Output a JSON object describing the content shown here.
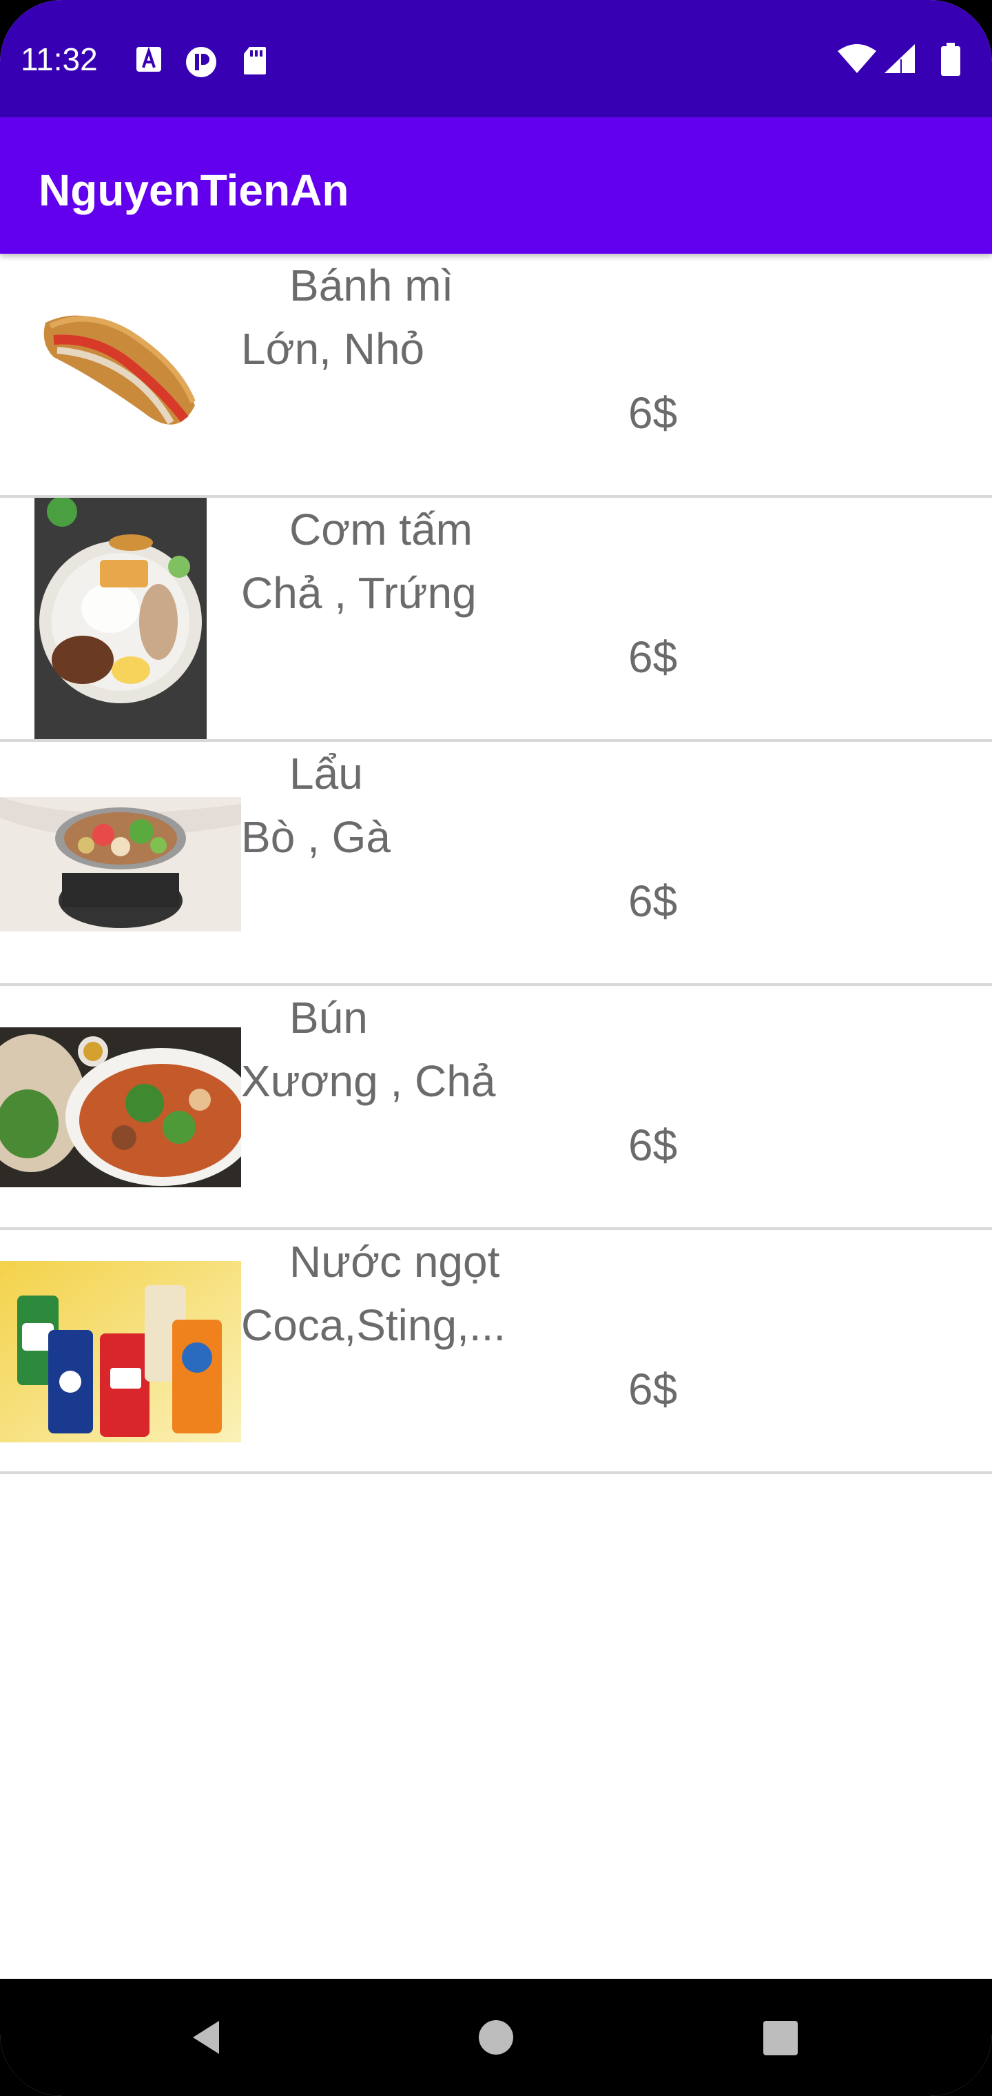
{
  "status_bar": {
    "time": "11:32",
    "left_icons": [
      "a-notification-icon",
      "p-notification-icon",
      "sd-card-icon"
    ],
    "right_icons": [
      "wifi-icon",
      "signal-icon",
      "battery-icon"
    ],
    "background": "#3700b3"
  },
  "app_bar": {
    "title": "NguyenTienAn",
    "background": "#6200ee"
  },
  "foods": [
    {
      "name": "Bánh mì",
      "options": "Lớn, Nhỏ",
      "price": "6$",
      "image": "banh-mi-image"
    },
    {
      "name": "Cơm tấm",
      "options": "Chả , Trứng",
      "price": "6$",
      "image": "com-tam-image"
    },
    {
      "name": "Lẩu",
      "options": "Bò , Gà",
      "price": "6$",
      "image": "lau-image"
    },
    {
      "name": "Bún",
      "options": "Xương , Chả",
      "price": "6$",
      "image": "bun-image"
    },
    {
      "name": "Nước ngọt",
      "options": "Coca,Sting,...",
      "price": "6$",
      "image": "soft-drinks-image"
    }
  ],
  "nav_bar": {
    "buttons": [
      "back-icon",
      "home-icon",
      "recents-icon"
    ]
  },
  "colors": {
    "text_gray": "#6b6b6b",
    "divider": "#d8d8d8"
  }
}
